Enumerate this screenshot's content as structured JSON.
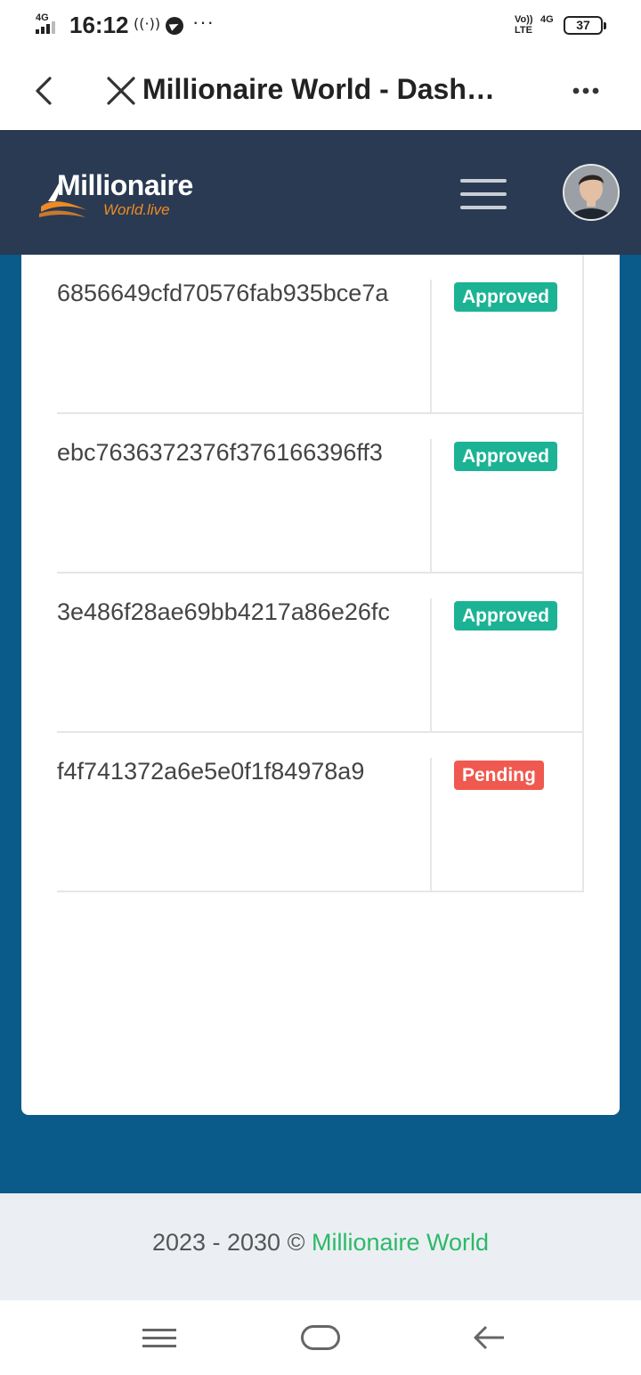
{
  "status_bar": {
    "network_gen": "4G",
    "time": "16:12",
    "hotspot_glyph": "((·))",
    "overflow": "···",
    "volte": "Vo))\nLTE",
    "data_gen": "4G",
    "battery": "37"
  },
  "browser": {
    "title": "Millionaire World - Dashboard"
  },
  "header": {
    "logo_main": "Millionaire",
    "logo_sub": "World.live"
  },
  "transactions": [
    {
      "hash": "6856649cfd70576fab935bce7a",
      "status": "Approved"
    },
    {
      "hash": "ebc7636372376f376166396ff3",
      "status": "Approved"
    },
    {
      "hash": "3e486f28ae69bb4217a86e26fc",
      "status": "Approved"
    },
    {
      "hash": "f4f741372a6e5e0f1f84978a9",
      "status": "Pending"
    }
  ],
  "footer": {
    "copyright": "2023 - 2030 © ",
    "brand": "Millionaire World"
  },
  "colors": {
    "header_bg": "#2a3a52",
    "main_bg": "#0a5a8a",
    "approved": "#1bb394",
    "pending": "#f0594f",
    "footer_brand": "#2cb968",
    "logo_accent": "#f08a24"
  },
  "icons": {
    "back": "chevron-left-icon",
    "close": "close-icon",
    "more": "more-horizontal-icon",
    "menu": "hamburger-icon",
    "nav_recents": "recents-icon",
    "nav_home": "home-icon",
    "nav_back": "back-arrow-icon"
  }
}
